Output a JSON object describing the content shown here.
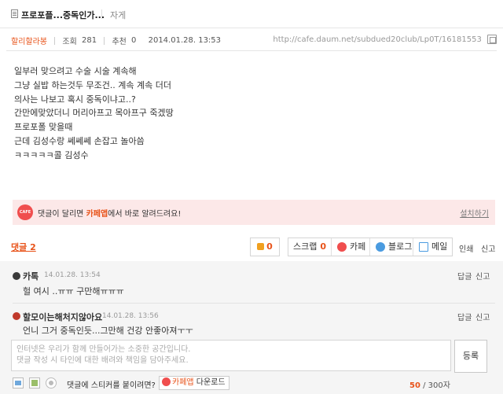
{
  "title_bar": {
    "title": "프로포플...중독인가...",
    "board": "자게"
  },
  "meta": {
    "author": "할리할라봉",
    "views_label": "조회",
    "views": "281",
    "recs_label": "추천",
    "recs": "0",
    "date": "2014.01.28. 13:53",
    "url": "http://cafe.daum.net/subdued20club/Lp0T/16181553"
  },
  "body_lines": [
    "일부러 맞으려고 수술 시술 계속해",
    "그냥 실밥 하는것두 무조건.. 계속 계속 더더",
    "의사는 나보고 혹시 중독이냐고..?",
    "간만에맞았더니 머리아프고 목아프구 죽겠땅",
    "프로포폴 맞을때",
    "근데 김성수랑 쎄쎄쎄 손잡고 놀아씀",
    "ㅋㅋㅋㅋㅋ콜 김성수"
  ],
  "app_banner": {
    "icon_text": "CAFE",
    "msg_prefix": "댓글이 달리면 ",
    "msg_highlight": "카페앱",
    "msg_suffix": "에서 바로 알려드려요!",
    "install": "설치하기"
  },
  "comments_label": "댓글 2",
  "actions": {
    "like_count": "0",
    "scrap_label": "스크랩",
    "scrap_count": "0",
    "cafe_label": "카페",
    "blog_label": "블로그",
    "mail_label": "메일",
    "print": "인쇄",
    "report": "신고"
  },
  "comments": [
    {
      "nick": "카톡",
      "time": "14.01.28. 13:54",
      "text": "헐 여시 ..ㅠㅠ 구만해ㅠㅠㅠ",
      "reply": "답글",
      "report": "신고"
    },
    {
      "nick": "할모이는해처지않아요",
      "time": "14.01.28. 13:56",
      "text": "언니 그거 중독인듯...그만해 건강 안좋아져ㅜㅜ",
      "reply": "답글",
      "report": "신고"
    }
  ],
  "composer": {
    "placeholder_line1": "인터넷은 우리가 함께 만들어가는 소중한 공간입니다.",
    "placeholder_line2": "댓글 작성 시 타인에 대한 배려와 책임을 담아주세요.",
    "submit": "등록",
    "sticker_question": "댓글에 스티커를 붙이려면?",
    "download_app": "카페앱",
    "download_label": " 다운로드",
    "count_current": "50",
    "count_max": " / 300자"
  },
  "colors": {
    "accent": "#e8531a",
    "banner_bg": "#fce8e8",
    "cafe_red": "#f04e4e",
    "blog_blue": "#4a9be0"
  }
}
